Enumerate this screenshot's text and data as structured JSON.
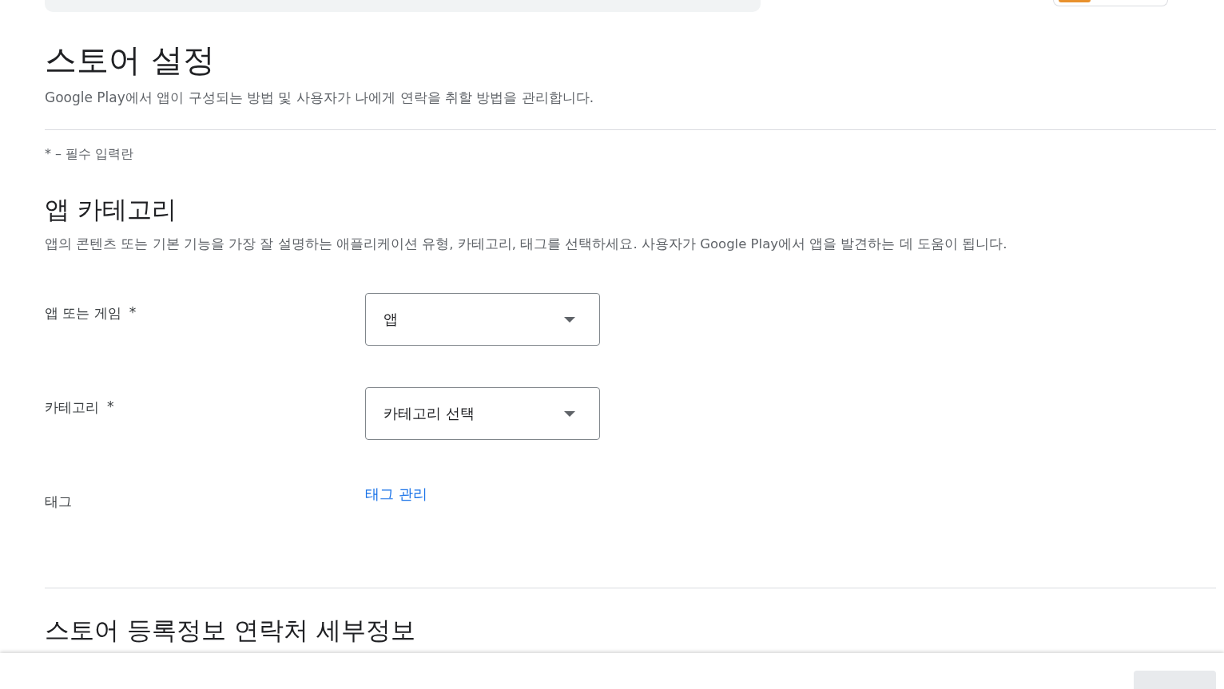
{
  "page": {
    "title": "스토어 설정",
    "description": "Google Play에서 앱이 구성되는 방법 및 사용자가 나에게 연락을 취할 방법을 관리합니다.",
    "required_note": "* – 필수 입력란"
  },
  "sections": [
    {
      "title": "앱 카테고리",
      "description": "앱의 콘텐츠 또는 기본 기능을 가장 잘 설명하는 애플리케이션 유형, 카테고리, 태그를 선택하세요. 사용자가 Google Play에서 앱을 발견하는 데 도움이 됩니다.",
      "fields": [
        {
          "kind": "dropdown",
          "label": "앱 또는 게임",
          "required_mark": "*",
          "value": "앱"
        },
        {
          "kind": "dropdown",
          "label": "카테고리",
          "required_mark": "*",
          "value": "카테고리 선택"
        },
        {
          "kind": "link",
          "label": "태그",
          "value": "태그 관리"
        }
      ]
    },
    {
      "title": "스토어 등록정보 연락처 세부정보"
    }
  ],
  "footer": {
    "buttons": [
      {
        "kind": "filled",
        "disabled": true
      }
    ]
  }
}
